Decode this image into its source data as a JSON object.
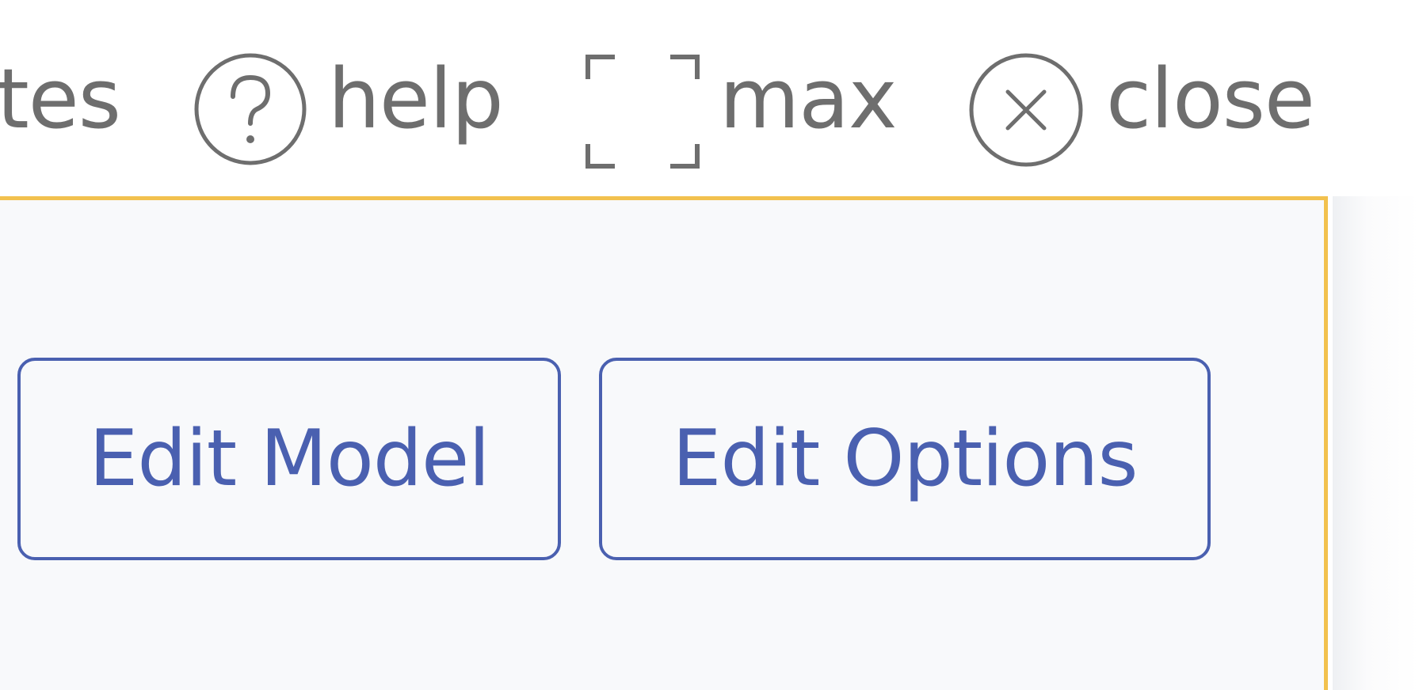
{
  "toolbar": {
    "notes_label": "tes",
    "help_label": "help",
    "max_label": "max",
    "close_label": "close",
    "icons": {
      "help": "help-circle-icon",
      "max": "maximize-brackets-icon",
      "close": "close-circle-icon"
    },
    "text_color": "#6e6e6e"
  },
  "panel": {
    "border_color": "#f2c14e",
    "background": "#f8f9fb",
    "buttons": {
      "edit_model": "Edit Model",
      "edit_options": "Edit Options"
    },
    "button_color": "#4a60b0"
  }
}
